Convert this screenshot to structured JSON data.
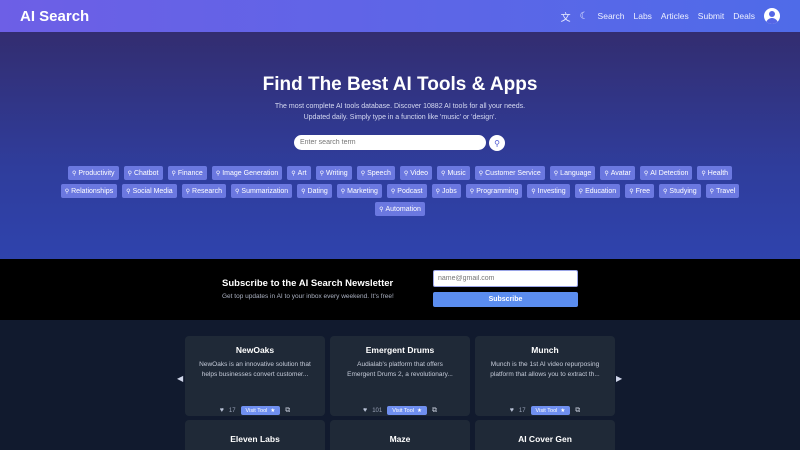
{
  "header": {
    "logo": "AI Search",
    "nav": [
      "Search",
      "Labs",
      "Articles",
      "Submit",
      "Deals"
    ],
    "icons": [
      "translate-icon",
      "moon-icon",
      "user-icon"
    ]
  },
  "hero": {
    "title": "Find The Best AI Tools & Apps",
    "desc_line1": "The most complete AI tools database. Discover 10882 AI tools for all your needs.",
    "desc_line2": "Updated daily. Simply type in a function like 'music' or 'design'.",
    "search_placeholder": "Enter search term",
    "tags": [
      "Productivity",
      "Chatbot",
      "Finance",
      "Image Generation",
      "Art",
      "Writing",
      "Speech",
      "Video",
      "Music",
      "Customer Service",
      "Language",
      "Avatar",
      "AI Detection",
      "Health",
      "Relationships",
      "Social Media",
      "Research",
      "Summarization",
      "Dating",
      "Marketing",
      "Podcast",
      "Jobs",
      "Programming",
      "Investing",
      "Education",
      "Free",
      "Studying",
      "Travel",
      "Automation"
    ]
  },
  "newsletter": {
    "title": "Subscribe to the AI Search Newsletter",
    "subtitle": "Get top updates in AI to your inbox every weekend. It's free!",
    "email_placeholder": "name@gmail.com",
    "button": "Subscribe"
  },
  "cards": [
    {
      "name": "NewOaks",
      "desc": "NewOaks is an innovative solution that helps businesses convert customer...",
      "likes": "17",
      "visit": "Visit Tool"
    },
    {
      "name": "Emergent Drums",
      "desc": "Audialab's platform that offers Emergent Drums 2, a revolutionary...",
      "likes": "101",
      "visit": "Visit Tool"
    },
    {
      "name": "Munch",
      "desc": "Munch is the 1st AI video repurposing platform that allows you to extract th...",
      "likes": "17",
      "visit": "Visit Tool"
    },
    {
      "name": "Eleven Labs"
    },
    {
      "name": "Maze"
    },
    {
      "name": "AI Cover Gen"
    }
  ]
}
